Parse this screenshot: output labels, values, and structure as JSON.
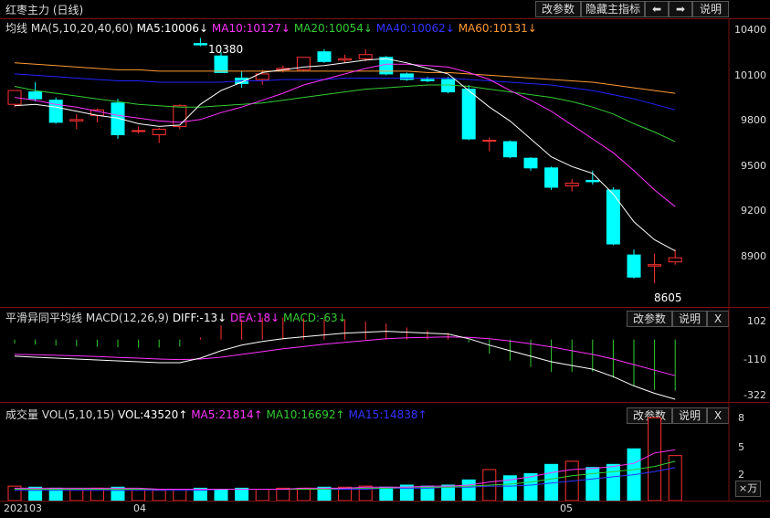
{
  "header": {
    "stock_title": "红枣主力 (日线)",
    "buttons": [
      "改参数",
      "隐藏主指标",
      "⬅",
      "➡",
      "说明"
    ]
  },
  "main": {
    "label": "均线",
    "ma_param": "MA(5,10,20,40,60)",
    "ma5": "MA5:10006↓",
    "ma10": "MA10:10127↓",
    "ma20": "MA20:10054↓",
    "ma40": "MA40:10062↓",
    "ma60": "MA60:10131↓",
    "colors": {
      "ma5": "#ffffff",
      "ma10": "#ff33ff",
      "ma20": "#33cc33",
      "ma40": "#2222ff",
      "ma60": "#ff9933"
    },
    "y_ticks": [
      "10400",
      "10100",
      "9800",
      "9500",
      "9200",
      "8900"
    ],
    "high_label": "10380",
    "low_label": "8605"
  },
  "macd": {
    "label": "平滑异同平均线",
    "param": "MACD(12,26,9)",
    "diff": "DIFF:-13↓",
    "dea": "DEA:18↓",
    "macd": "MACD:-63↓",
    "y_ticks": [
      "102",
      "-110",
      "-322"
    ],
    "buttons": [
      "改参数",
      "说明",
      "X"
    ]
  },
  "volume": {
    "label": "成交量",
    "param": "VOL(5,10,15)",
    "vol": "VOL:43520↑",
    "ma5": "MA5:21814↑",
    "ma10": "MA10:16692↑",
    "ma15": "MA15:14838↑",
    "y_ticks": [
      "8",
      "5",
      "2"
    ],
    "unit": "×万",
    "buttons": [
      "改参数",
      "说明",
      "X"
    ]
  },
  "x_axis": [
    "202103",
    "04",
    "05"
  ],
  "chart_data": {
    "type": "candlestick",
    "ylim": [
      8500,
      10450
    ],
    "candles": [
      {
        "o": 9900,
        "h": 9980,
        "l": 9880,
        "c": 10000
      },
      {
        "o": 9990,
        "h": 10060,
        "l": 9920,
        "c": 9940
      },
      {
        "o": 9930,
        "h": 9950,
        "l": 9760,
        "c": 9770
      },
      {
        "o": 9780,
        "h": 9830,
        "l": 9720,
        "c": 9790
      },
      {
        "o": 9820,
        "h": 9870,
        "l": 9770,
        "c": 9860
      },
      {
        "o": 9910,
        "h": 9940,
        "l": 9650,
        "c": 9680
      },
      {
        "o": 9710,
        "h": 9740,
        "l": 9690,
        "c": 9710
      },
      {
        "o": 9680,
        "h": 9730,
        "l": 9620,
        "c": 9720
      },
      {
        "o": 9740,
        "h": 9900,
        "l": 9720,
        "c": 9890
      },
      {
        "o": 10340,
        "h": 10380,
        "l": 10320,
        "c": 10330
      },
      {
        "o": 10250,
        "h": 10280,
        "l": 10130,
        "c": 10130
      },
      {
        "o": 10090,
        "h": 10140,
        "l": 10020,
        "c": 10050
      },
      {
        "o": 10080,
        "h": 10150,
        "l": 10040,
        "c": 10120
      },
      {
        "o": 10150,
        "h": 10180,
        "l": 10130,
        "c": 10160
      },
      {
        "o": 10150,
        "h": 10240,
        "l": 10140,
        "c": 10240
      },
      {
        "o": 10280,
        "h": 10300,
        "l": 10200,
        "c": 10210
      },
      {
        "o": 10220,
        "h": 10260,
        "l": 10200,
        "c": 10230
      },
      {
        "o": 10230,
        "h": 10300,
        "l": 10210,
        "c": 10260
      },
      {
        "o": 10240,
        "h": 10250,
        "l": 10110,
        "c": 10120
      },
      {
        "o": 10120,
        "h": 10130,
        "l": 10070,
        "c": 10080
      },
      {
        "o": 10080,
        "h": 10100,
        "l": 10060,
        "c": 10070
      },
      {
        "o": 10080,
        "h": 10100,
        "l": 9980,
        "c": 9990
      },
      {
        "o": 10010,
        "h": 10040,
        "l": 9640,
        "c": 9650
      },
      {
        "o": 9640,
        "h": 9660,
        "l": 9560,
        "c": 9640
      },
      {
        "o": 9630,
        "h": 9640,
        "l": 9510,
        "c": 9520
      },
      {
        "o": 9510,
        "h": 9520,
        "l": 9420,
        "c": 9440
      },
      {
        "o": 9440,
        "h": 9450,
        "l": 9280,
        "c": 9300
      },
      {
        "o": 9310,
        "h": 9360,
        "l": 9270,
        "c": 9330
      },
      {
        "o": 9350,
        "h": 9420,
        "l": 9320,
        "c": 9340
      },
      {
        "o": 9280,
        "h": 9300,
        "l": 8880,
        "c": 8890
      },
      {
        "o": 8810,
        "h": 8850,
        "l": 8640,
        "c": 8650
      },
      {
        "o": 8730,
        "h": 8820,
        "l": 8605,
        "c": 8740
      },
      {
        "o": 8760,
        "h": 8850,
        "l": 8740,
        "c": 8790
      }
    ],
    "ma5": [
      9890,
      9900,
      9880,
      9850,
      9820,
      9800,
      9760,
      9740,
      9750,
      9900,
      10000,
      10060,
      10130,
      10150,
      10170,
      10180,
      10200,
      10220,
      10230,
      10200,
      10160,
      10120,
      10000,
      9880,
      9780,
      9650,
      9520,
      9450,
      9400,
      9250,
      9050,
      8920,
      8840
    ],
    "ma10": [
      9950,
      9930,
      9900,
      9880,
      9850,
      9820,
      9800,
      9780,
      9770,
      9790,
      9840,
      9880,
      9930,
      9980,
      10040,
      10080,
      10120,
      10160,
      10190,
      10190,
      10180,
      10170,
      10130,
      10080,
      10000,
      9930,
      9850,
      9750,
      9650,
      9550,
      9420,
      9280,
      9160
    ],
    "ma20": [
      10030,
      10000,
      9980,
      9960,
      9940,
      9920,
      9900,
      9890,
      9880,
      9880,
      9890,
      9900,
      9910,
      9930,
      9950,
      9970,
      9990,
      10010,
      10020,
      10030,
      10040,
      10040,
      10030,
      10010,
      9990,
      9970,
      9950,
      9920,
      9880,
      9830,
      9760,
      9700,
      9630
    ],
    "ma40": [
      10120,
      10110,
      10100,
      10090,
      10080,
      10070,
      10070,
      10060,
      10060,
      10060,
      10060,
      10070,
      10070,
      10080,
      10080,
      10080,
      10090,
      10090,
      10090,
      10090,
      10090,
      10090,
      10080,
      10070,
      10060,
      10050,
      10040,
      10020,
      10000,
      9970,
      9940,
      9900,
      9860
    ],
    "ma60": [
      10200,
      10190,
      10180,
      10170,
      10160,
      10150,
      10150,
      10140,
      10140,
      10140,
      10140,
      10140,
      10140,
      10140,
      10140,
      10140,
      10140,
      10140,
      10140,
      10140,
      10130,
      10130,
      10120,
      10110,
      10100,
      10090,
      10080,
      10070,
      10060,
      10040,
      10020,
      10000,
      9980
    ],
    "macd_ylim": [
      -322,
      102
    ],
    "diff": [
      -90,
      -95,
      -100,
      -105,
      -110,
      -115,
      -120,
      -125,
      -125,
      -100,
      -60,
      -30,
      -10,
      5,
      15,
      25,
      35,
      40,
      45,
      40,
      35,
      30,
      5,
      -30,
      -60,
      -90,
      -120,
      -140,
      -160,
      -200,
      -250,
      -290,
      -322
    ],
    "dea": [
      -80,
      -82,
      -85,
      -88,
      -92,
      -96,
      -100,
      -105,
      -108,
      -105,
      -95,
      -80,
      -65,
      -50,
      -38,
      -25,
      -15,
      -5,
      5,
      10,
      12,
      14,
      12,
      5,
      -8,
      -22,
      -40,
      -60,
      -80,
      -105,
      -135,
      -165,
      -195
    ],
    "macd_bar": [
      -20,
      -25,
      -30,
      -34,
      -36,
      -38,
      -40,
      -40,
      -35,
      10,
      70,
      100,
      110,
      110,
      106,
      100,
      100,
      90,
      80,
      60,
      46,
      32,
      -14,
      -70,
      -104,
      -136,
      -160,
      -160,
      -160,
      -190,
      -230,
      -250,
      -254
    ],
    "vol_ylim": [
      0,
      8.2
    ],
    "volume": [
      1.4,
      1.3,
      1.2,
      1.1,
      1.2,
      1.3,
      1.1,
      1.0,
      1.1,
      1.2,
      1.1,
      1.2,
      1.1,
      1.2,
      1.2,
      1.3,
      1.3,
      1.4,
      1.3,
      1.5,
      1.4,
      1.5,
      2.0,
      3.0,
      2.4,
      2.6,
      3.5,
      3.8,
      3.2,
      3.5,
      5.0,
      8.0,
      4.35
    ],
    "vol_ma5": [
      1.2,
      1.2,
      1.2,
      1.2,
      1.2,
      1.2,
      1.2,
      1.1,
      1.1,
      1.1,
      1.1,
      1.1,
      1.1,
      1.1,
      1.2,
      1.2,
      1.2,
      1.3,
      1.3,
      1.3,
      1.4,
      1.4,
      1.5,
      1.8,
      2.0,
      2.3,
      2.7,
      3.0,
      3.1,
      3.3,
      3.6,
      4.6,
      4.9
    ],
    "vol_ma10": [
      1.1,
      1.1,
      1.1,
      1.1,
      1.1,
      1.1,
      1.1,
      1.1,
      1.1,
      1.1,
      1.1,
      1.1,
      1.1,
      1.1,
      1.1,
      1.1,
      1.2,
      1.2,
      1.2,
      1.3,
      1.3,
      1.3,
      1.4,
      1.5,
      1.6,
      1.8,
      2.1,
      2.4,
      2.6,
      2.8,
      3.0,
      3.3,
      3.8
    ],
    "vol_ma15": [
      1.0,
      1.0,
      1.0,
      1.0,
      1.0,
      1.0,
      1.0,
      1.0,
      1.0,
      1.0,
      1.1,
      1.1,
      1.1,
      1.1,
      1.1,
      1.1,
      1.1,
      1.1,
      1.2,
      1.2,
      1.2,
      1.3,
      1.3,
      1.4,
      1.4,
      1.5,
      1.7,
      1.9,
      2.1,
      2.3,
      2.5,
      2.8,
      3.2
    ]
  }
}
